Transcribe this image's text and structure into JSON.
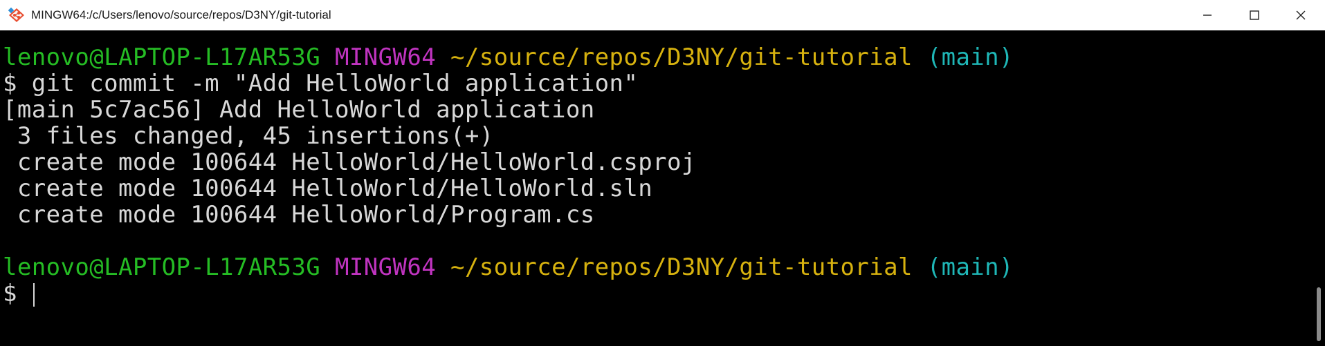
{
  "window": {
    "title": "MINGW64:/c/Users/lenovo/source/repos/D3NY/git-tutorial",
    "icons": {
      "app": "git-bash-icon",
      "minimize": "minimize-icon",
      "maximize": "maximize-icon",
      "close": "close-icon"
    }
  },
  "terminal": {
    "prompt1": {
      "user": "lenovo@LAPTOP-L17AR53G",
      "mingw": "MINGW64",
      "path": "~/source/repos/D3NY/git-tutorial",
      "branch": "(main)"
    },
    "command": "$ git commit -m \"Add HelloWorld application\"",
    "output": [
      "[main 5c7ac56] Add HelloWorld application",
      " 3 files changed, 45 insertions(+)",
      " create mode 100644 HelloWorld/HelloWorld.csproj",
      " create mode 100644 HelloWorld/HelloWorld.sln",
      " create mode 100644 HelloWorld/Program.cs"
    ],
    "prompt2": {
      "user": "lenovo@LAPTOP-L17AR53G",
      "mingw": "MINGW64",
      "path": "~/source/repos/D3NY/git-tutorial",
      "branch": "(main)"
    },
    "input_prompt": "$ "
  },
  "colors": {
    "background": "#000000",
    "text": "#d8d8d8",
    "user": "#25bc24",
    "mingw": "#c034c0",
    "path": "#d7b20f",
    "branch": "#1fb7b7"
  }
}
